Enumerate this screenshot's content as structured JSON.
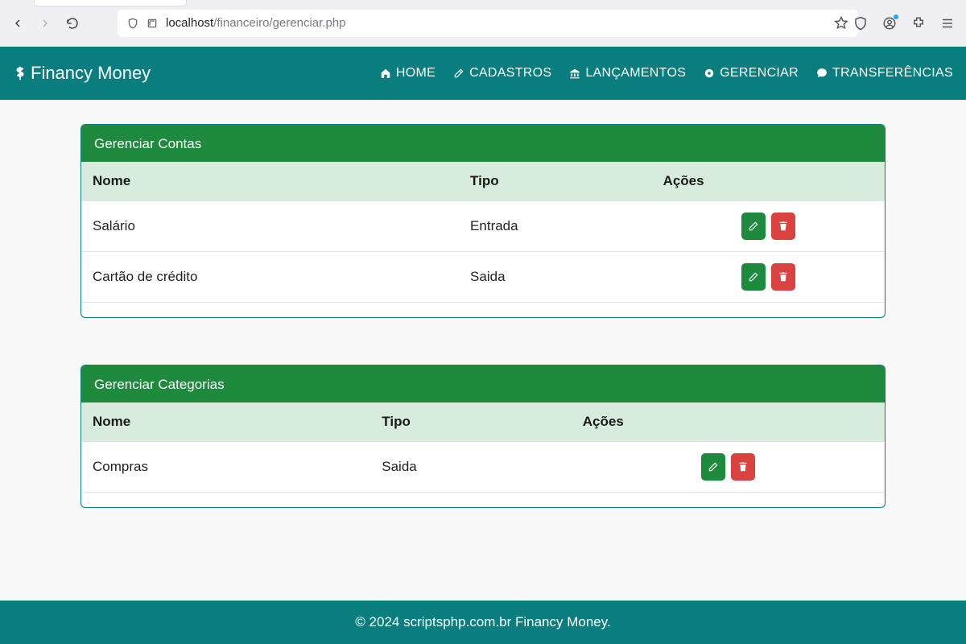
{
  "browser": {
    "url_domain": "localhost",
    "url_path": "/financeiro/gerenciar.php"
  },
  "brand": "Financy Money",
  "nav": {
    "home": "HOME",
    "cadastros": "CADASTROS",
    "lancamentos": "LANÇAMENTOS",
    "gerenciar": "GERENCIAR",
    "transferencias": "TRANSFERÊNCIAS"
  },
  "tables": {
    "contas": {
      "title": "Gerenciar Contas",
      "headers": {
        "nome": "Nome",
        "tipo": "Tipo",
        "acoes": "Ações"
      },
      "rows": [
        {
          "nome": "Salário",
          "tipo": "Entrada"
        },
        {
          "nome": "Cartão de crédito",
          "tipo": "Saida"
        }
      ]
    },
    "categorias": {
      "title": "Gerenciar Categorias",
      "headers": {
        "nome": "Nome",
        "tipo": "Tipo",
        "acoes": "Ações"
      },
      "rows": [
        {
          "nome": "Compras",
          "tipo": "Saida"
        }
      ]
    }
  },
  "footer": "© 2024 scriptsphp.com.br Financy Money."
}
